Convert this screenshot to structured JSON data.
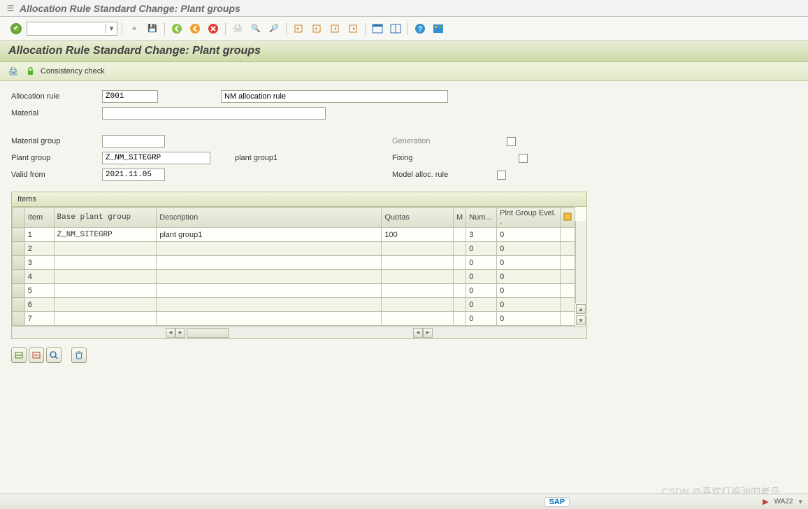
{
  "titlebar": {
    "title": "Allocation Rule Standard Change: Plant groups"
  },
  "header": {
    "title": "Allocation Rule Standard Change: Plant groups"
  },
  "subtoolbar": {
    "consistency_check": "Consistency check"
  },
  "form": {
    "allocation_rule_label": "Allocation rule",
    "allocation_rule_value": "Z001",
    "allocation_rule_desc": "NM allocation rule",
    "material_label": "Material",
    "material_value": "",
    "material_group_label": "Material group",
    "material_group_value": "",
    "plant_group_label": "Plant group",
    "plant_group_value": "Z_NM_SITEGRP",
    "plant_group_desc": "plant group1",
    "valid_from_label": "Valid from",
    "valid_from_value": "2021.11.05",
    "generation_label": "Generation",
    "fixing_label": "Fixing",
    "model_alloc_rule_label": "Model alloc. rule"
  },
  "items": {
    "title": "Items",
    "columns": {
      "item": "Item",
      "base_plant_group": "Base plant group",
      "description": "Description",
      "quotas": "Quotas",
      "m": "M",
      "num": "Num...",
      "plnt_group_evel": "Plnt Group Evel. ."
    },
    "rows": [
      {
        "item": "1",
        "bpg": "Z_NM_SITEGRP",
        "desc": "plant group1",
        "quotas": "100",
        "m": "",
        "num": "3",
        "pge": "0"
      },
      {
        "item": "2",
        "bpg": "",
        "desc": "",
        "quotas": "",
        "m": "",
        "num": "0",
        "pge": "0"
      },
      {
        "item": "3",
        "bpg": "",
        "desc": "",
        "quotas": "",
        "m": "",
        "num": "0",
        "pge": "0"
      },
      {
        "item": "4",
        "bpg": "",
        "desc": "",
        "quotas": "",
        "m": "",
        "num": "0",
        "pge": "0"
      },
      {
        "item": "5",
        "bpg": "",
        "desc": "",
        "quotas": "",
        "m": "",
        "num": "0",
        "pge": "0"
      },
      {
        "item": "6",
        "bpg": "",
        "desc": "",
        "quotas": "",
        "m": "",
        "num": "0",
        "pge": "0"
      },
      {
        "item": "7",
        "bpg": "",
        "desc": "",
        "quotas": "",
        "m": "",
        "num": "0",
        "pge": "0"
      }
    ]
  },
  "footer": {
    "sap": "SAP",
    "sys": "WA22",
    "watermark": "CSDN @喜欢打酱油的老鸟"
  }
}
